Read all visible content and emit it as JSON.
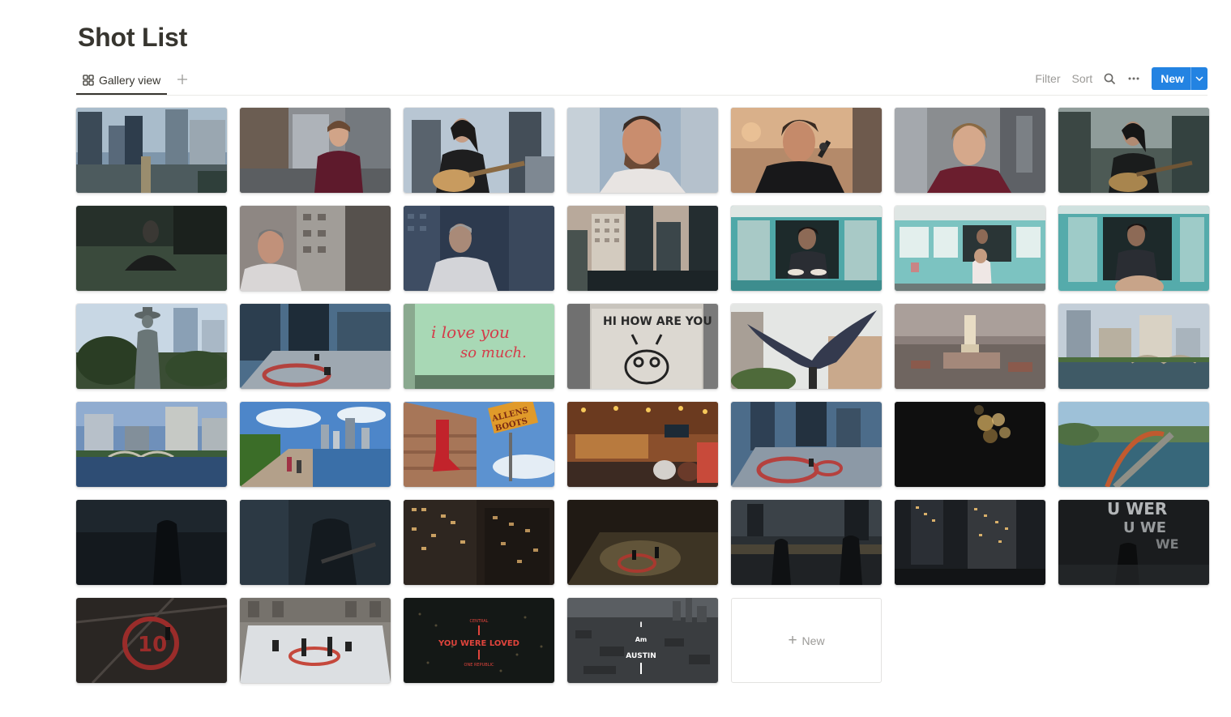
{
  "page": {
    "title": "Shot List"
  },
  "views": {
    "active_tab": "Gallery view",
    "add_view_icon": "plus-icon"
  },
  "toolbar": {
    "filter": "Filter",
    "sort": "Sort",
    "search_icon": "search-icon",
    "more_icon": "ellipsis-icon",
    "new_label": "New"
  },
  "gallery": {
    "new_card_label": "New",
    "card_texts": {
      "love_wall": [
        "i love you",
        "so much."
      ],
      "hi_wall": "HI HOW ARE YOU",
      "boots_sign": [
        "ALLENS",
        "BOOTS"
      ],
      "loved_title": "YOU WERE LOVED",
      "loved_small_top": "CENTRAL",
      "loved_small_bottom": "ONE REPUBLIC",
      "austin_i": "I",
      "austin_am": "Am",
      "austin_city": "AUSTIN",
      "wer_lines": [
        "U WER",
        "U WE",
        "WE"
      ],
      "circle_number": "10"
    }
  }
}
